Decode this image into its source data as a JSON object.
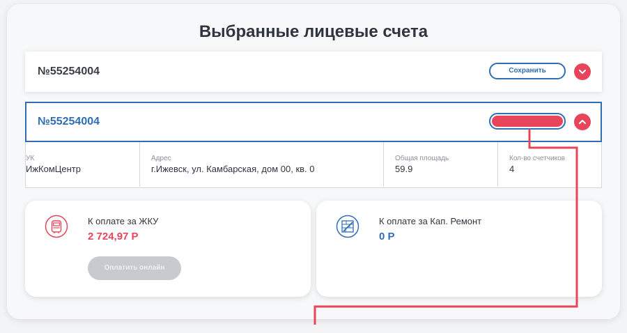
{
  "page": {
    "title": "Выбранные лицевые счета"
  },
  "accounts": [
    {
      "number": "№55254004",
      "save_label": "Сохранить",
      "expanded": false
    },
    {
      "number": "№55254004",
      "expanded": true
    }
  ],
  "details": {
    "uk_label": "УК",
    "uk_value": "ИжКомЦентр",
    "address_label": "Адрес",
    "address_value": "г.Ижевск, ул. Камбарская, дом 00, кв. 0",
    "area_label": "Общая площадь",
    "area_value": "59.9",
    "meters_label": "Кол-во счетчиков",
    "meters_value": "4"
  },
  "payments": {
    "zhku": {
      "title": "К оплате за ЖКУ",
      "amount": "2 724,97 Р",
      "button": "Оплатить онлайн",
      "icon": "meter-icon"
    },
    "kap_remont": {
      "title": "К оплате за Кап. Ремонт",
      "amount": "0 Р",
      "icon": "repair-icon"
    }
  },
  "colors": {
    "accent_blue": "#2f6db5",
    "accent_red": "#e8445a",
    "disabled_gray": "#c7cace"
  }
}
